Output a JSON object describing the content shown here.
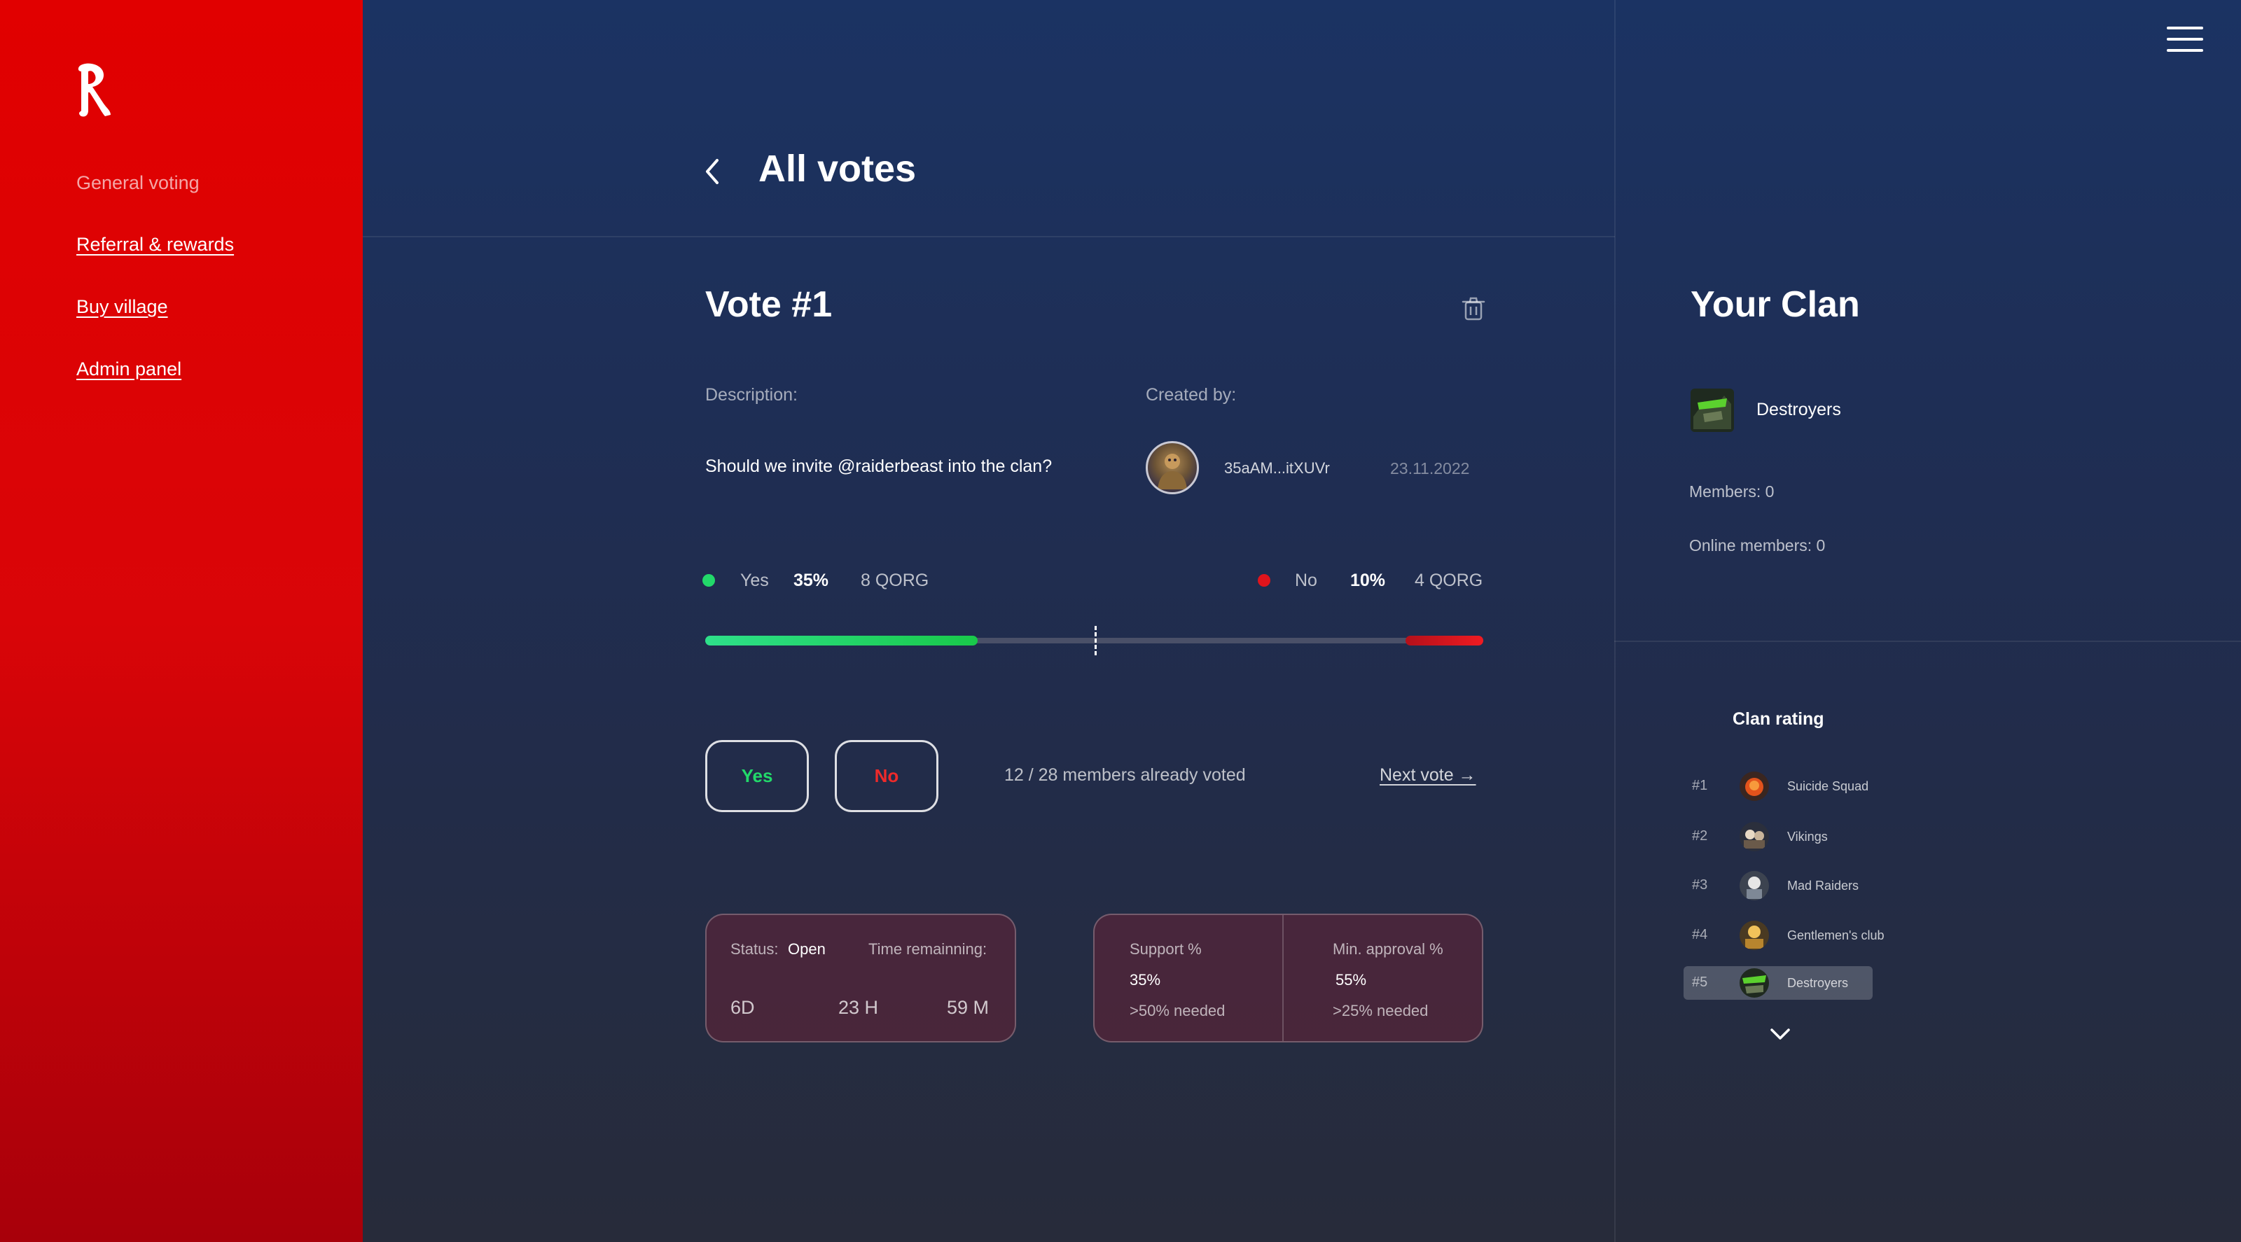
{
  "sidebar": {
    "items": [
      {
        "label": "General voting"
      },
      {
        "label": "Referral & rewards"
      },
      {
        "label": "Buy village"
      },
      {
        "label": "Admin panel"
      }
    ]
  },
  "header": {
    "title": "All votes"
  },
  "vote": {
    "title": "Vote #1",
    "description_label": "Description:",
    "created_by_label": "Created by:",
    "description": "Should we invite @raiderbeast into the clan?",
    "creator_address": "35aAM...itXUVr",
    "created_date": "23.11.2022",
    "yes": {
      "label": "Yes",
      "percent": "35%",
      "amount": "8 QORG",
      "fraction": 0.35,
      "color": "#22d96a"
    },
    "no": {
      "label": "No",
      "percent": "10%",
      "amount": "4 QORG",
      "fraction": 0.1,
      "color": "#e0141c"
    },
    "threshold_fraction": 0.5,
    "yes_button": "Yes",
    "no_button": "No",
    "voted_count": "12 / 28 members already voted",
    "next_vote": "Next vote →"
  },
  "status_card": {
    "status_label": "Status:",
    "status_value": "Open",
    "time_label": "Time remainning:",
    "days": "6D",
    "hours": "23 H",
    "minutes": "59 M"
  },
  "approval_card": {
    "support_label": "Support %",
    "support_value": "35%",
    "support_needed": ">50% needed",
    "min_label": "Min. approval %",
    "min_value": "55%",
    "min_needed": ">25% needed"
  },
  "clan": {
    "title": "Your Clan",
    "name": "Destroyers",
    "members": "Members: 0",
    "online_members": "Online members: 0"
  },
  "rating": {
    "title": "Clan rating",
    "rows": [
      {
        "rank": "#1",
        "name": "Suicide Squad"
      },
      {
        "rank": "#2",
        "name": "Vikings"
      },
      {
        "rank": "#3",
        "name": "Mad Raiders"
      },
      {
        "rank": "#4",
        "name": "Gentlemen's club"
      },
      {
        "rank": "#5",
        "name": "Destroyers"
      }
    ]
  },
  "colors": {
    "sidebar": "#e10000",
    "yes": "#22d96a",
    "no": "#e0141c",
    "background": "#1f2d52"
  },
  "icons": [
    "logo-icon",
    "back-arrow-icon",
    "trash-icon",
    "menu-icon",
    "chevron-down-icon"
  ]
}
